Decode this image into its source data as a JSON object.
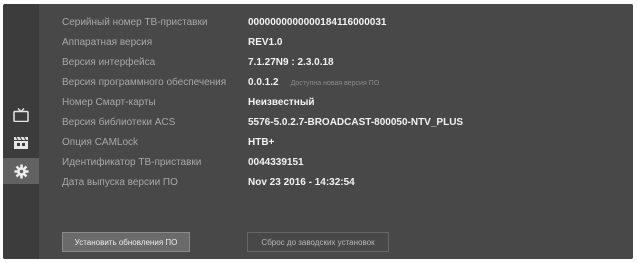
{
  "sidebar": {
    "items": [
      {
        "icon": "tv-icon"
      },
      {
        "icon": "clapperboard-icon"
      },
      {
        "icon": "gear-icon",
        "active": true
      }
    ]
  },
  "info": {
    "rows": [
      {
        "label": "Серийный номер ТВ-приставки",
        "value": "0000000000000184116000031"
      },
      {
        "label": "Аппаратная версия",
        "value": "REV1.0"
      },
      {
        "label": "Версия интерфейса",
        "value": "7.1.27N9 : 2.3.0.18"
      },
      {
        "label": "Версия программного обеспечения",
        "value": "0.0.1.2",
        "note": "Доступна новая версия ПО"
      },
      {
        "label": "Номер Смарт-карты",
        "value": "Неизвестный"
      },
      {
        "label": "Версия библиотеки ACS",
        "value": "5576-5.0.2.7-BROADCAST-800050-NTV_PLUS"
      },
      {
        "label": "Опция CAMLock",
        "value": "НТВ+"
      },
      {
        "label": "Идентификатор ТВ-приставки",
        "value": "0044339151"
      },
      {
        "label": "Дата выпуска версии ПО",
        "value": "Nov 23 2016 - 14:32:54"
      }
    ]
  },
  "buttons": {
    "install_update": "Установить обновления ПО",
    "factory_reset": "Сброс до заводских установок"
  }
}
